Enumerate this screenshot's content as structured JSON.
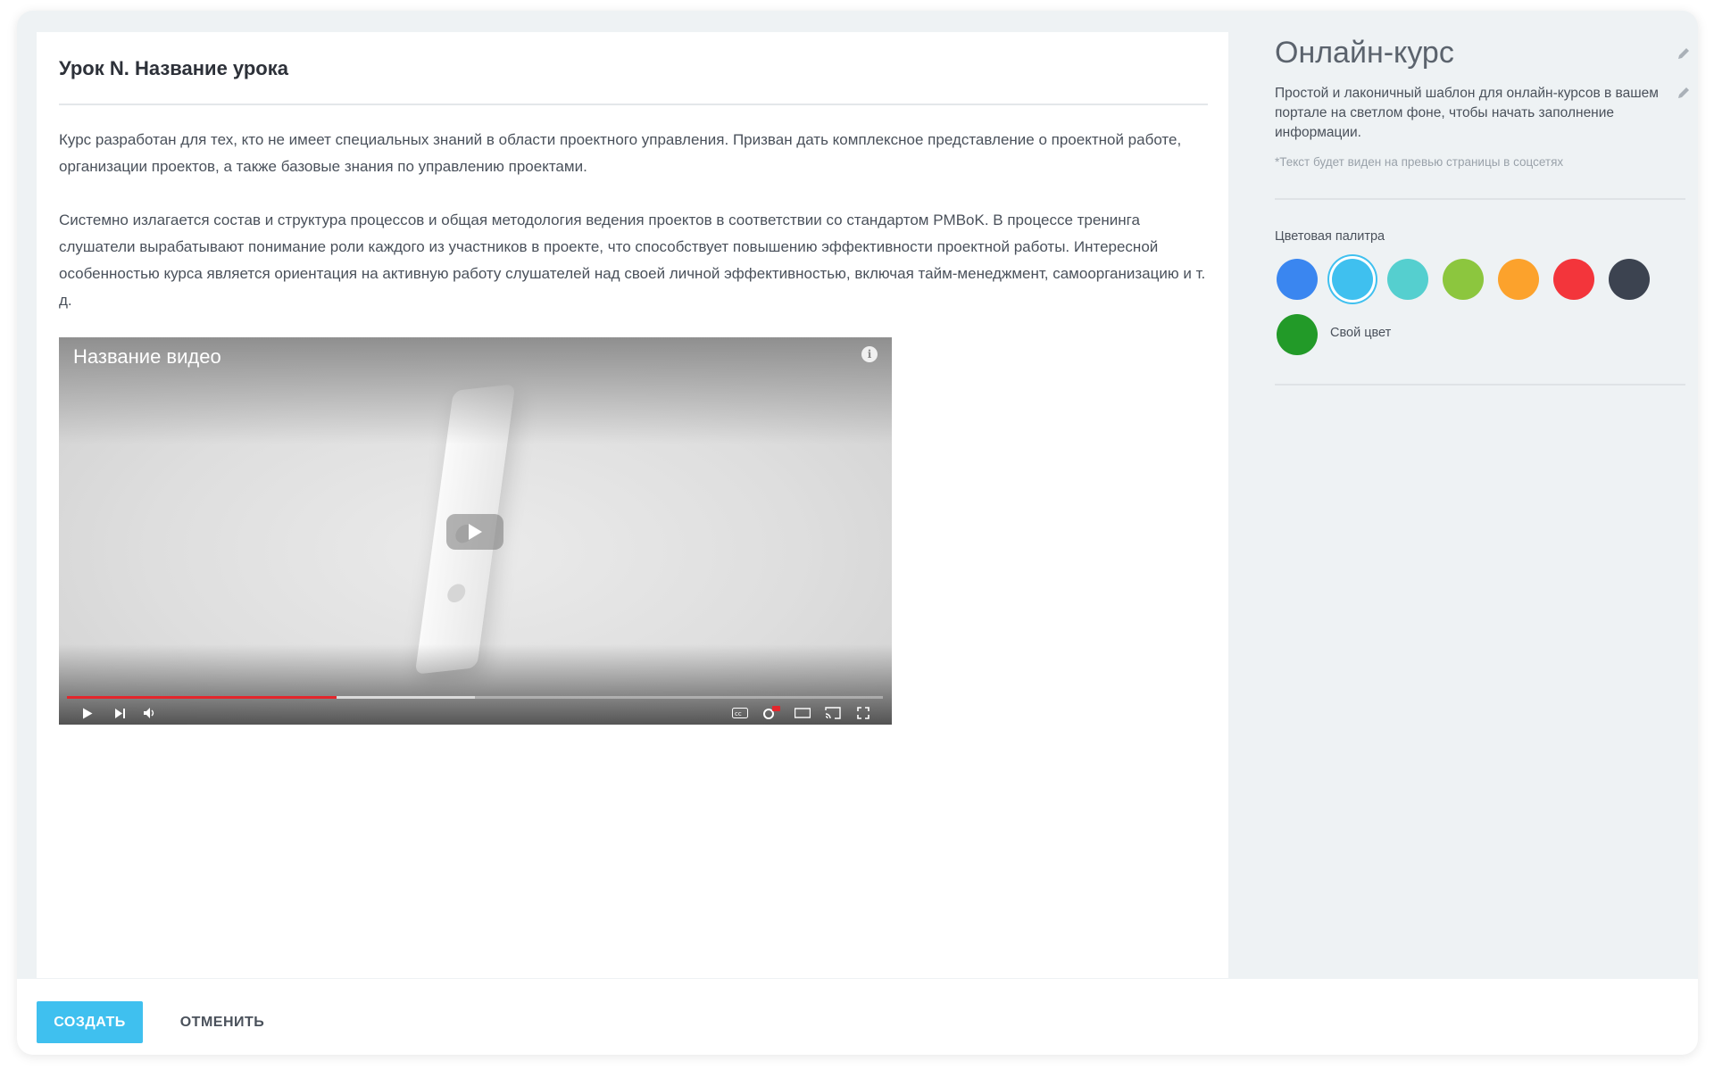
{
  "lesson": {
    "title": "Урок N. Название урока",
    "paragraphs": [
      "Курс разработан для тех, кто не имеет специальных знаний в области проектного управления. Призван дать комплексное представление о проектной работе, организации проектов, а также базовые знания по управлению проектами.",
      "Системно излагается состав и структура процессов и общая методология ведения проектов в соответствии со стандартом PMBoK. В процессе тренинга слушатели вырабатывают понимание роли каждого из участников в проекте, что способствует повышению эффективности проектной работы. Интересной особенностью курса является ориентация на активную работу слушателей над своей личной эффективностью, включая тайм-менеджмент, самоорганизацию и т. д."
    ],
    "video": {
      "title": "Название видео",
      "played_fraction": 0.33,
      "buffered_fraction": 0.5
    }
  },
  "sidebar": {
    "course_title": "Онлайн-курс",
    "description": "Простой и лаконичный шаблон для онлайн-курсов в вашем портале на светлом фоне, чтобы начать заполнение информации.",
    "note": "*Текст будет виден на превью страницы в соцсетях",
    "palette_label": "Цветовая палитра",
    "palette": [
      {
        "color": "#3a86f0",
        "selected": false
      },
      {
        "color": "#3fc0ef",
        "selected": true
      },
      {
        "color": "#55cfcf",
        "selected": false
      },
      {
        "color": "#8cc63e",
        "selected": false
      },
      {
        "color": "#fca22c",
        "selected": false
      },
      {
        "color": "#f3353b",
        "selected": false
      },
      {
        "color": "#3c4350",
        "selected": false
      }
    ],
    "custom_color": {
      "color": "#229a28",
      "label": "Свой цвет"
    }
  },
  "footer": {
    "create_label": "СОЗДАТЬ",
    "cancel_label": "ОТМЕНИТЬ"
  },
  "colors": {
    "accent": "#3fc0ef",
    "progress": "#e3262c"
  }
}
